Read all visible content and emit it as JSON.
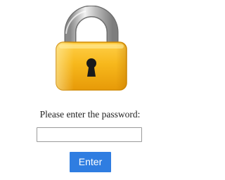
{
  "lock": {
    "icon": "padlock-icon",
    "body_color": "#f4b41a",
    "shackle_color": "#c8c8c8"
  },
  "prompt": {
    "text": "Please enter the password:"
  },
  "password": {
    "value": "",
    "placeholder": ""
  },
  "enter_button": {
    "label": "Enter",
    "color": "#2f7de1"
  }
}
